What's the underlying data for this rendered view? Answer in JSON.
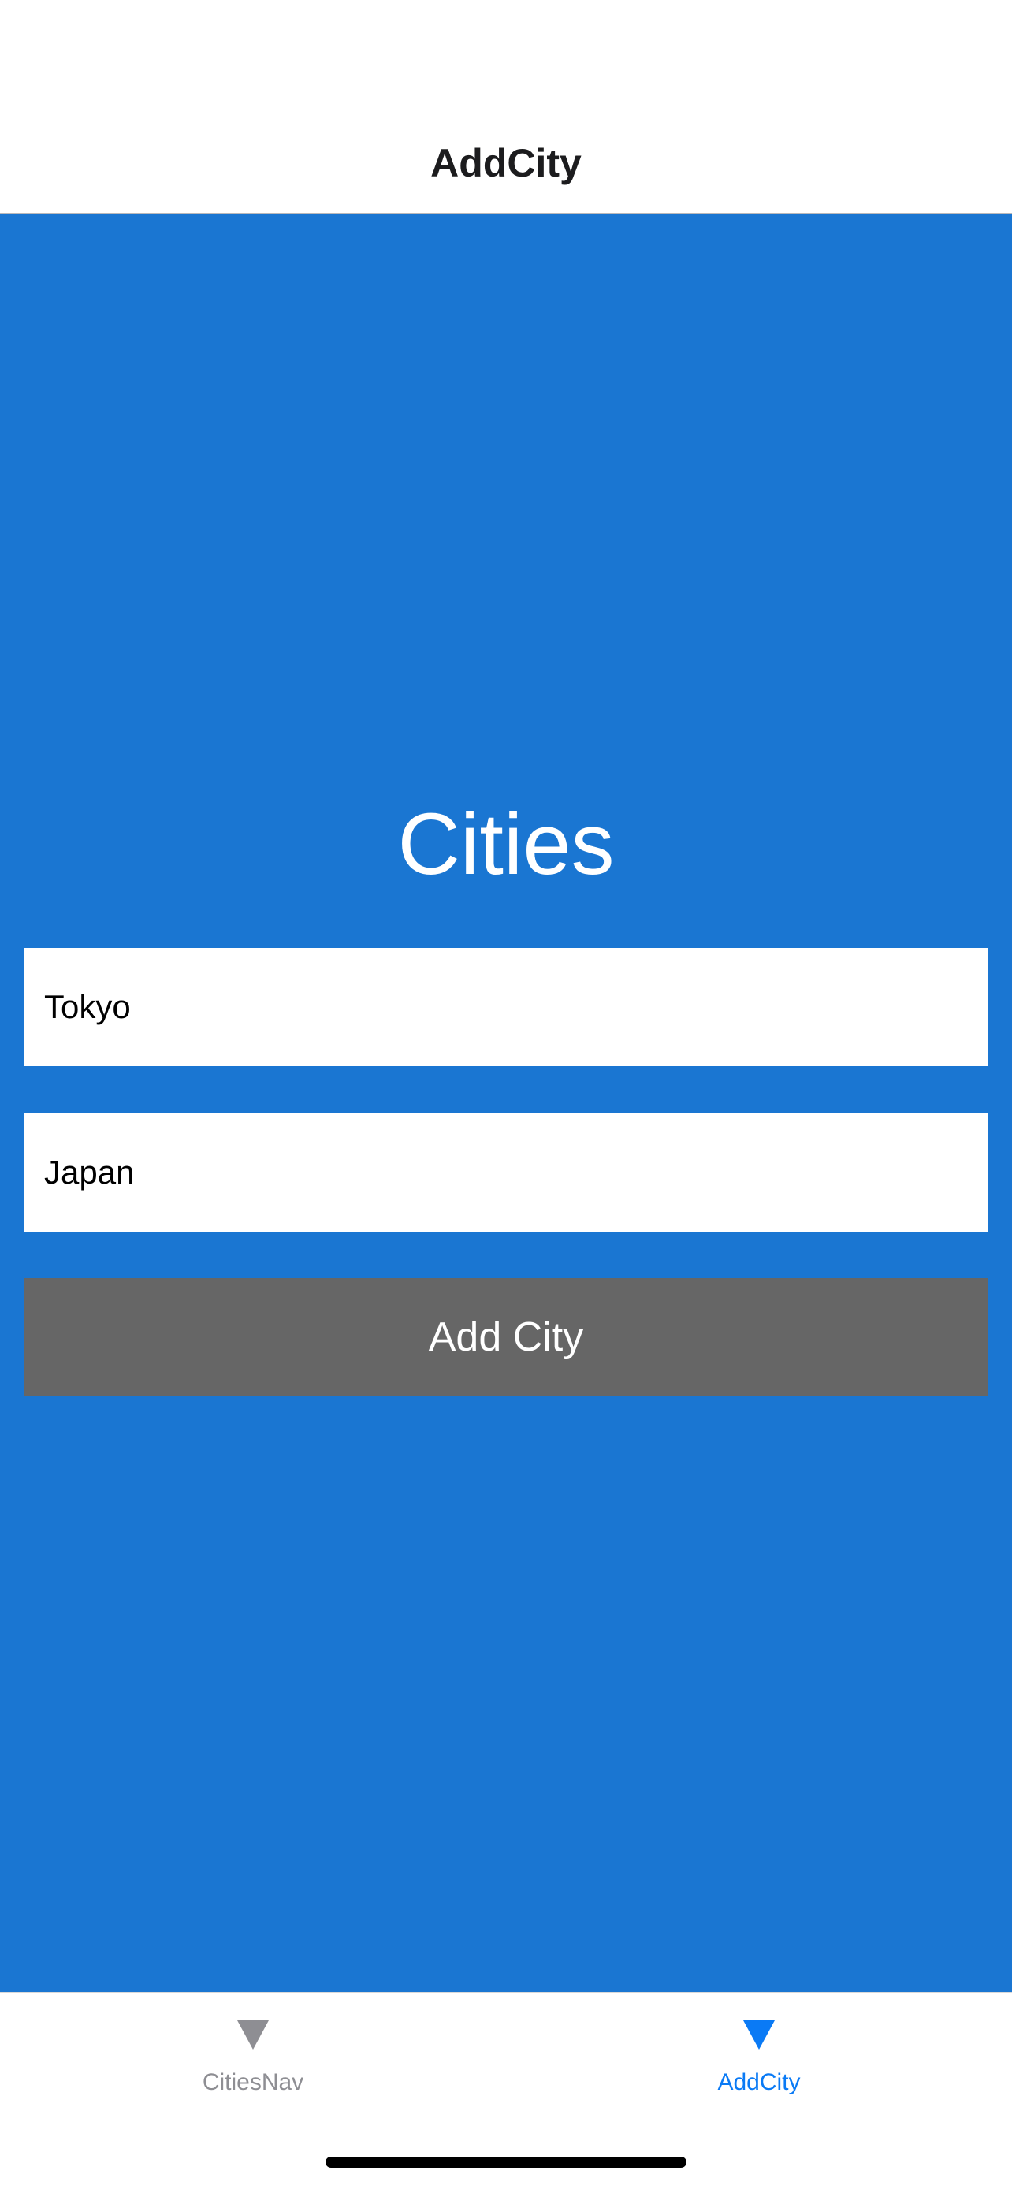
{
  "colors": {
    "content_background": "#1a76d2",
    "tab_active": "#0a7af5",
    "tab_inactive": "#8e8e93",
    "button_background": "#666666"
  },
  "nav_bar": {
    "title": "AddCity"
  },
  "form": {
    "heading": "Cities",
    "city_input": {
      "value": "Tokyo",
      "placeholder": ""
    },
    "country_input": {
      "value": "Japan",
      "placeholder": ""
    },
    "add_button_label": "Add City"
  },
  "tab_bar": {
    "tabs": [
      {
        "label": "CitiesNav",
        "icon": "triangle-down-icon",
        "active": false
      },
      {
        "label": "AddCity",
        "icon": "triangle-down-icon",
        "active": true
      }
    ]
  }
}
